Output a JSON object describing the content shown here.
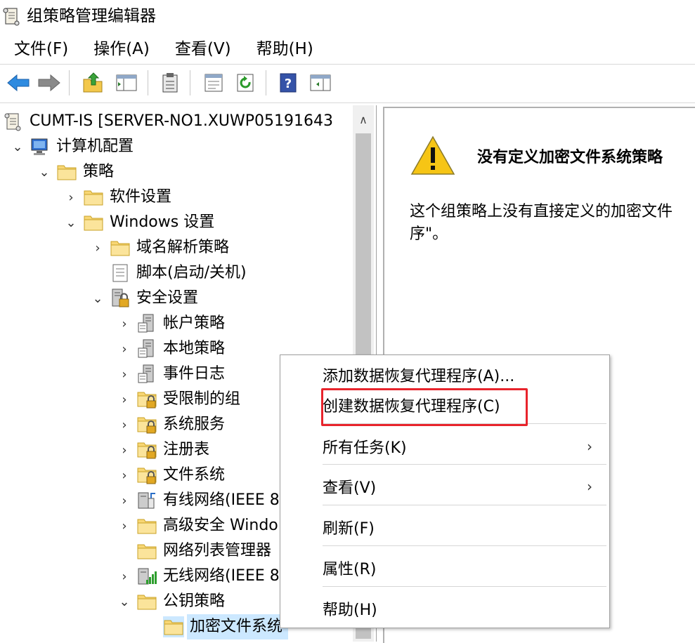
{
  "window": {
    "title": "组策略管理编辑器"
  },
  "menubar": {
    "items": [
      "文件(F)",
      "操作(A)",
      "查看(V)",
      "帮助(H)"
    ]
  },
  "toolbar": {
    "icons": [
      "back-arrow-icon",
      "forward-arrow-icon",
      "up-folder-icon",
      "show-hide-tree-icon",
      "clipboard-icon",
      "properties-icon",
      "refresh-icon",
      "help-icon",
      "show-action-pane-icon"
    ]
  },
  "tree": {
    "items": [
      {
        "label": "CUMT-IS [SERVER-NO1.XUWP05191643"
      },
      {
        "label": "计算机配置"
      },
      {
        "label": "策略"
      },
      {
        "label": "软件设置"
      },
      {
        "label": "Windows 设置"
      },
      {
        "label": "域名解析策略"
      },
      {
        "label": "脚本(启动/关机)"
      },
      {
        "label": "安全设置"
      },
      {
        "label": "帐户策略"
      },
      {
        "label": "本地策略"
      },
      {
        "label": "事件日志"
      },
      {
        "label": "受限制的组"
      },
      {
        "label": "系统服务"
      },
      {
        "label": "注册表"
      },
      {
        "label": "文件系统"
      },
      {
        "label": "有线网络(IEEE 8"
      },
      {
        "label": "高级安全 Windo"
      },
      {
        "label": "网络列表管理器"
      },
      {
        "label": "无线网络(IEEE 8"
      },
      {
        "label": "公钥策略"
      },
      {
        "label": "加密文件系统"
      }
    ]
  },
  "content": {
    "heading": "没有定义加密文件系统策略",
    "body": "这个组策略上没有直接定义的加密文件\n序\"。"
  },
  "context_menu": {
    "items": [
      {
        "label": "添加数据恢复代理程序(A)..."
      },
      {
        "label": "创建数据恢复代理程序(C)"
      },
      {
        "label": "所有任务(K)",
        "submenu_arrow": "›"
      },
      {
        "label": "查看(V)",
        "submenu_arrow": "›"
      },
      {
        "label": "刷新(F)"
      },
      {
        "label": "属性(R)"
      },
      {
        "label": "帮助(H)"
      }
    ]
  },
  "colors": {
    "highlight_border": "#e8242c",
    "selection_bg": "#cce8ff"
  }
}
